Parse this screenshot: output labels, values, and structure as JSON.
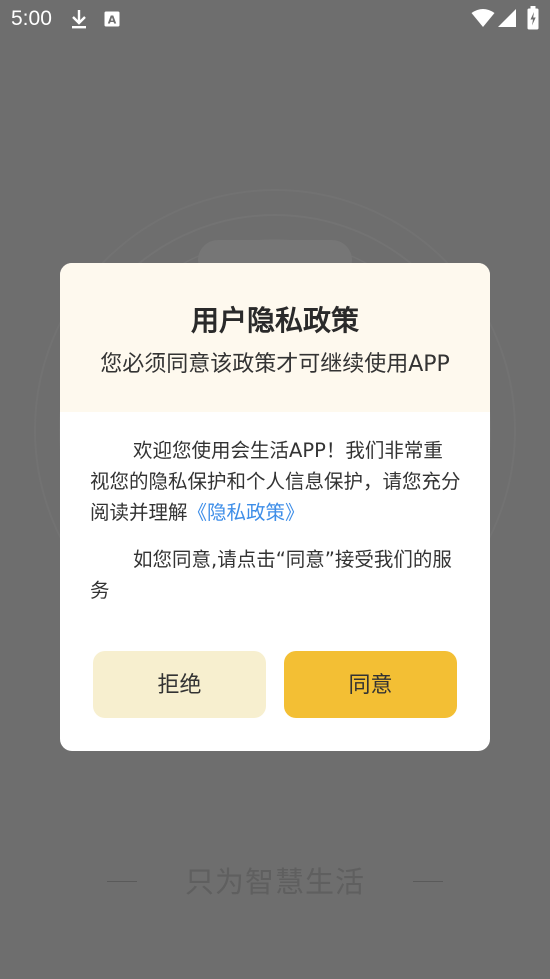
{
  "status_bar": {
    "time": "5:00",
    "icons": [
      "download-icon",
      "font-icon",
      "wifi-icon",
      "signal-icon",
      "battery-icon"
    ]
  },
  "background": {
    "tagline": "只为智慧生活"
  },
  "dialog": {
    "title": "用户隐私政策",
    "subtitle": "您必须同意该政策才可继续使用APP",
    "paragraph1_text": "欢迎您使用会生活APP！我们非常重视您的隐私保护和个人信息保护，请您充分阅读并理解",
    "paragraph1_link": "《隐私政策》",
    "paragraph2_text": "如您同意,请点击“同意”接受我们的服务",
    "reject_label": "拒绝",
    "agree_label": "同意"
  },
  "colors": {
    "overlay": "#6e6e6e",
    "header_bg": "#fef9ee",
    "link": "#3e8ee8",
    "agree_button": "#f3bf34",
    "reject_button": "#f7efcf"
  }
}
